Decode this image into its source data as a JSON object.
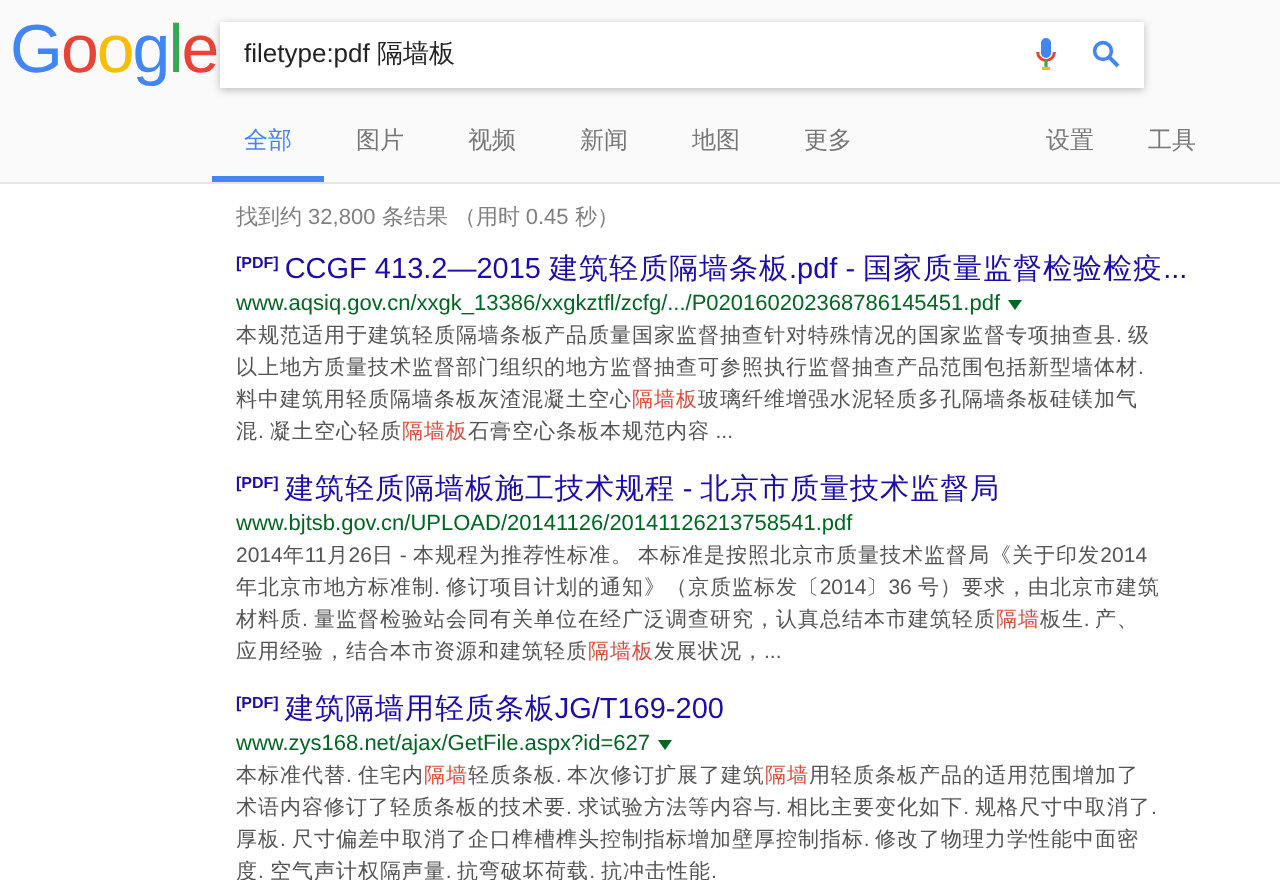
{
  "logo": "Google",
  "search": {
    "value": "filetype:pdf 隔墙板"
  },
  "tabs": [
    {
      "label": "全部",
      "selected": true
    },
    {
      "label": "图片",
      "selected": false
    },
    {
      "label": "视频",
      "selected": false
    },
    {
      "label": "新闻",
      "selected": false
    },
    {
      "label": "地图",
      "selected": false
    },
    {
      "label": "更多",
      "selected": false
    }
  ],
  "tools": [
    "设置",
    "工具"
  ],
  "result_stats": "找到约 32,800 条结果 （用时 0.45 秒）",
  "results": [
    {
      "badge": "[PDF]",
      "title": "CCGF 413.2—2015 建筑轻质隔墙条板.pdf - 国家质量监督检验检疫...",
      "url": "www.aqsiq.gov.cn/xxgk_13386/xxgkztfl/zcfg/.../P020160202368786145451.pdf",
      "url_menu": true,
      "snippet": [
        {
          "text": "本规范适用于建筑轻质隔墙条板产品质量国家监督抽查针对特殊情况的国家监督专项抽查县. 级以上地方质量技术监督部门组织的地方监督抽查可参照执行监督抽查产品范围包括新型墙体材. 料中建筑用轻质隔墙条板灰渣混凝土空心",
          "highlight": false
        },
        {
          "text": "隔墙板",
          "highlight": true
        },
        {
          "text": "玻璃纤维增强水泥轻质多孔隔墙条板硅镁加气混. 凝土空心轻质",
          "highlight": false
        },
        {
          "text": "隔墙板",
          "highlight": true
        },
        {
          "text": "石膏空心条板本规范内容 ...",
          "highlight": false
        }
      ]
    },
    {
      "badge": "[PDF]",
      "title": "建筑轻质隔墙板施工技术规程 - 北京市质量技术监督局",
      "url": "www.bjtsb.gov.cn/UPLOAD/20141126/20141126213758541.pdf",
      "url_menu": false,
      "snippet": [
        {
          "text": "2014年11月26日 - 本规程为推荐性标准。 本标准是按照北京市质量技术监督局《关于印发2014 年北京市地方标准制. 修订项目计划的通知》（京质监标发〔2014〕36 号）要求，由北京市建筑材料质. 量监督检验站会同有关单位在经广泛调查研究，认真总结本市建筑轻质",
          "highlight": false
        },
        {
          "text": "隔墙",
          "highlight": true
        },
        {
          "text": "板生. 产、应用经验，结合本市资源和建筑轻质",
          "highlight": false
        },
        {
          "text": "隔墙板",
          "highlight": true
        },
        {
          "text": "发展状况，...",
          "highlight": false
        }
      ]
    },
    {
      "badge": "[PDF]",
      "title": "建筑隔墙用轻质条板JG/T169-200",
      "url": "www.zys168.net/ajax/GetFile.aspx?id=627",
      "url_menu": true,
      "snippet": [
        {
          "text": "本标准代替. 住宅内",
          "highlight": false
        },
        {
          "text": "隔墙",
          "highlight": true
        },
        {
          "text": "轻质条板. 本次修订扩展了建筑",
          "highlight": false
        },
        {
          "text": "隔墙",
          "highlight": true
        },
        {
          "text": "用轻质条板产品的适用范围增加了术语内容修订了轻质条板的技术要. 求试验方法等内容与. 相比主要变化如下. 规格尺寸中取消了. 厚板. 尺寸偏差中取消了企口榫槽榫头控制指标增加壁厚控制指标. 修改了物理力学性能中面密度. 空气声计权隔声量. 抗弯破坏荷载. 抗冲击性能.",
          "highlight": false
        }
      ]
    }
  ]
}
